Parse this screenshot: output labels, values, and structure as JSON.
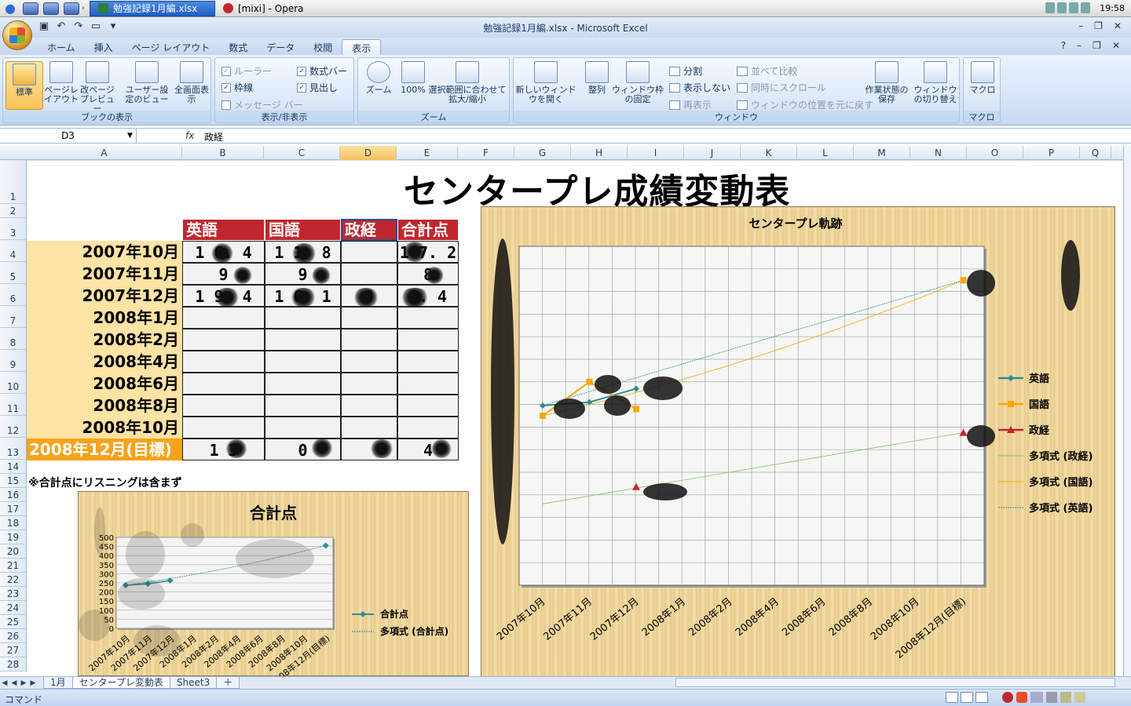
{
  "taskbar": {
    "tasks": [
      {
        "label": "勉強記録1月編.xlsx",
        "active": true
      },
      {
        "label": "[mixi] - Opera",
        "active": false
      }
    ],
    "clock": "19:58"
  },
  "window": {
    "title": "勉強記録1月編.xlsx - Microsoft Excel"
  },
  "ribbon": {
    "tabs": [
      "ホーム",
      "挿入",
      "ページ レイアウト",
      "数式",
      "データ",
      "校閲",
      "表示"
    ],
    "active_tab": "表示",
    "groups": {
      "book_view": {
        "label": "ブックの表示",
        "buttons": [
          "標準",
          "ページレイアウト",
          "改ページプレビュー",
          "ユーザー設定のビュー",
          "全画面表示"
        ]
      },
      "show_hide": {
        "label": "表示/非表示",
        "checks": [
          {
            "label": "ルーラー",
            "checked": true,
            "disabled": true
          },
          {
            "label": "数式バー",
            "checked": true,
            "disabled": false
          },
          {
            "label": "枠線",
            "checked": true,
            "disabled": false
          },
          {
            "label": "見出し",
            "checked": true,
            "disabled": false
          },
          {
            "label": "メッセージ バー",
            "checked": false,
            "disabled": true
          }
        ]
      },
      "zoom": {
        "label": "ズーム",
        "buttons": [
          "ズーム",
          "100%",
          "選択範囲に合わせて拡大/縮小"
        ]
      },
      "window": {
        "label": "ウィンドウ",
        "buttons": [
          "新しいウィンドウを開く",
          "整列",
          "ウィンドウ枠の固定"
        ],
        "small": [
          {
            "label": "分割",
            "disabled": false
          },
          {
            "label": "表示しない",
            "disabled": false
          },
          {
            "label": "再表示",
            "disabled": true
          },
          {
            "label": "並べて比較",
            "disabled": true
          },
          {
            "label": "同時にスクロール",
            "disabled": true
          },
          {
            "label": "ウィンドウの位置を元に戻す",
            "disabled": true
          }
        ],
        "buttons2": [
          "作業状態の保存",
          "ウィンドウの切り替え"
        ]
      },
      "macro": {
        "label": "マクロ",
        "buttons": [
          "マクロ"
        ]
      }
    }
  },
  "formula_bar": {
    "name_box": "D3",
    "fx": "fx",
    "formula": "政経"
  },
  "sheet": {
    "columns": [
      "A",
      "B",
      "C",
      "D",
      "E",
      "F",
      "G",
      "H",
      "I",
      "J",
      "K",
      "L",
      "M",
      "N",
      "O",
      "P",
      "Q"
    ],
    "selected_column": "D",
    "rows": [
      "1",
      "2",
      "3",
      "4",
      "5",
      "6",
      "7",
      "8",
      "9",
      "10",
      "11",
      "12",
      "13",
      "14",
      "15",
      "16",
      "17",
      "18",
      "19",
      "20",
      "21",
      "22",
      "23",
      "24",
      "25",
      "26",
      "27",
      "28"
    ],
    "title": "センタープレ成績変動表",
    "headers": [
      "英語",
      "国語",
      "政経",
      "合計点"
    ],
    "row_labels": [
      "2007年10月",
      "2007年11月",
      "2007年12月",
      "2008年1月",
      "2008年2月",
      "2008年4月",
      "2008年6月",
      "2008年8月",
      "2008年10月",
      "2008年12月(目標)"
    ],
    "values": [
      [
        "1 6. 4",
        "1 1. 8",
        "",
        "1 7. 2"
      ],
      [
        "9",
        "9",
        "",
        "8"
      ],
      [
        "1 9. 4",
        "1 6. 1",
        "9",
        "3. 4"
      ],
      [
        "",
        "",
        "",
        ""
      ],
      [
        "",
        "",
        "",
        ""
      ],
      [
        "",
        "",
        "",
        ""
      ],
      [
        "",
        "",
        "",
        ""
      ],
      [
        "",
        "",
        "",
        ""
      ],
      [
        "",
        "",
        "",
        ""
      ],
      [
        "1 3",
        "0",
        "",
        "4"
      ]
    ],
    "note": "※合計点にリスニングは含まず"
  },
  "chart_data": [
    {
      "type": "line",
      "title": "センタープレ軌跡",
      "categories": [
        "2007年10月",
        "2007年11月",
        "2007年12月",
        "2008年1月",
        "2008年2月",
        "2008年4月",
        "2008年6月",
        "2008年8月",
        "2008年10月",
        "2008年12月(目標)"
      ],
      "series": [
        {
          "name": "英語",
          "color": "#2e8b9a",
          "values": [
            0.53,
            0.54,
            0.58,
            null,
            null,
            null,
            null,
            null,
            null,
            0.9
          ]
        },
        {
          "name": "国語",
          "color": "#f7a800",
          "values": [
            0.5,
            0.6,
            0.52,
            null,
            null,
            null,
            null,
            null,
            null,
            0.9
          ]
        },
        {
          "name": "政経",
          "color": "#c0272d",
          "values": [
            null,
            null,
            0.29,
            null,
            null,
            null,
            null,
            null,
            null,
            0.45
          ]
        },
        {
          "name": "多項式 (政経)",
          "color": "#7cc35a",
          "trend": true
        },
        {
          "name": "多項式 (国語)",
          "color": "#f7a800",
          "trend": true
        },
        {
          "name": "多項式 (英語)",
          "color": "#2e8b9a",
          "trend": true
        }
      ],
      "legend": "right",
      "grid": true
    },
    {
      "type": "line",
      "title": "合計点",
      "categories": [
        "2007年10月",
        "2007年11月",
        "2007年12月",
        "2008年1月",
        "2008年2月",
        "2008年4月",
        "2008年6月",
        "2008年8月",
        "2008年10月",
        "2008年12月(目標)"
      ],
      "y_ticks": [
        "0",
        "50",
        "100",
        "150",
        "200",
        "250",
        "300",
        "350",
        "400",
        "450",
        "500"
      ],
      "ylim": [
        0,
        500
      ],
      "series": [
        {
          "name": "合計点",
          "color": "#2e8b9a",
          "values": [
            237,
            245,
            263,
            null,
            null,
            null,
            null,
            null,
            null,
            455
          ]
        },
        {
          "name": "多項式 (合計点)",
          "color": "#2e8b9a",
          "trend": true
        }
      ],
      "legend": "right",
      "grid": true
    }
  ],
  "sheet_tabs": [
    "1月",
    "センタープレ変動表",
    "Sheet3"
  ],
  "active_sheet": "センタープレ変動表",
  "status": "コマンド"
}
